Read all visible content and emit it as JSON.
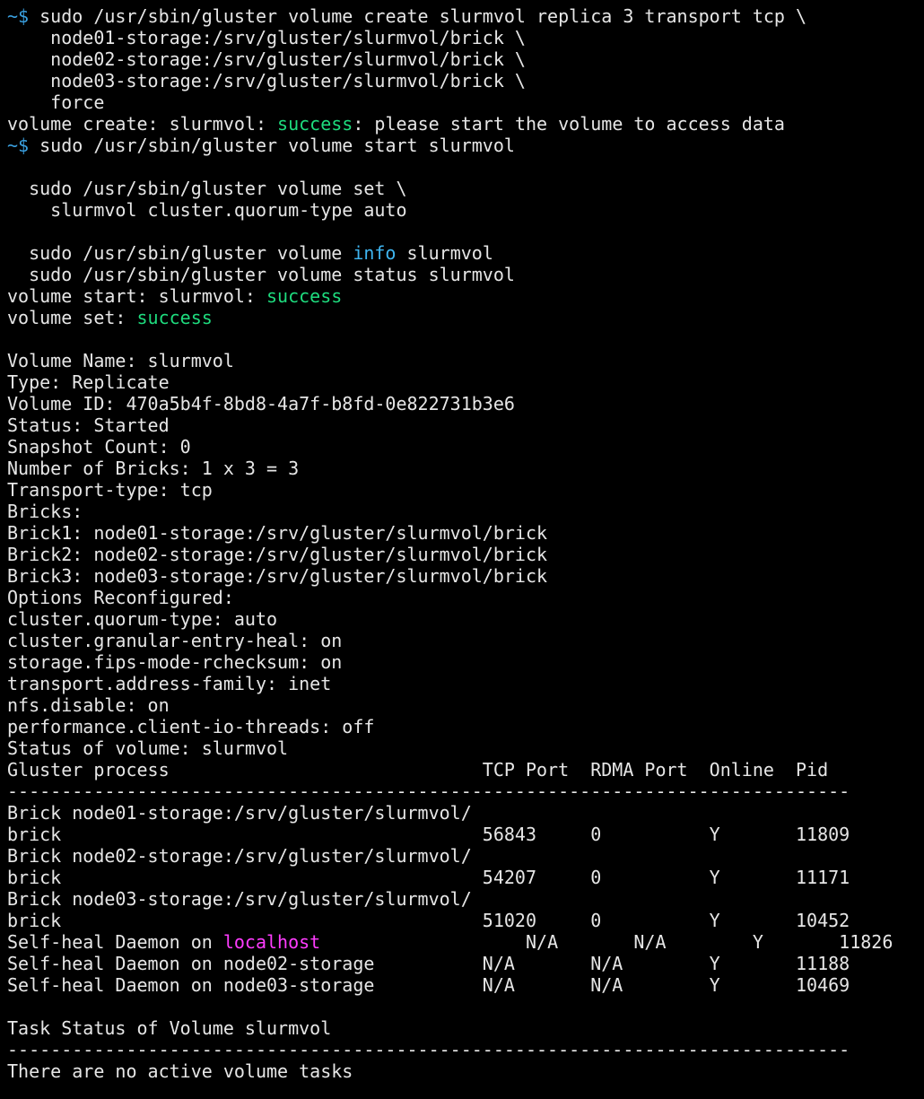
{
  "terminal": {
    "colors": {
      "background": "#000000",
      "foreground": "#e6e6e6",
      "prompt": "#3aa0e0",
      "success": "#1edc7e",
      "info": "#3fb5f0",
      "localhost": "#ff3cff"
    },
    "lines": [
      [
        {
          "t": "~$ ",
          "c": "prompt"
        },
        {
          "t": "sudo /usr/sbin/gluster volume create slurmvol replica 3 transport tcp \\"
        }
      ],
      [
        {
          "t": "    node01-storage:/srv/gluster/slurmvol/brick \\"
        }
      ],
      [
        {
          "t": "    node02-storage:/srv/gluster/slurmvol/brick \\"
        }
      ],
      [
        {
          "t": "    node03-storage:/srv/gluster/slurmvol/brick \\"
        }
      ],
      [
        {
          "t": "    force"
        }
      ],
      [
        {
          "t": "volume create: slurmvol: "
        },
        {
          "t": "success",
          "c": "green"
        },
        {
          "t": ": please start the volume to access data"
        }
      ],
      [
        {
          "t": "~$ ",
          "c": "prompt"
        },
        {
          "t": "sudo /usr/sbin/gluster volume start slurmvol"
        }
      ],
      [],
      [
        {
          "t": "  sudo /usr/sbin/gluster volume set \\"
        }
      ],
      [
        {
          "t": "    slurmvol cluster.quorum-type auto"
        }
      ],
      [],
      [
        {
          "t": "  sudo /usr/sbin/gluster volume "
        },
        {
          "t": "info",
          "c": "blue"
        },
        {
          "t": " slurmvol"
        }
      ],
      [
        {
          "t": "  sudo /usr/sbin/gluster volume status slurmvol"
        }
      ],
      [
        {
          "t": "volume start: slurmvol: "
        },
        {
          "t": "success",
          "c": "green"
        }
      ],
      [
        {
          "t": "volume set: "
        },
        {
          "t": "success",
          "c": "green"
        }
      ],
      [],
      [
        {
          "t": "Volume Name: slurmvol"
        }
      ],
      [
        {
          "t": "Type: Replicate"
        }
      ],
      [
        {
          "t": "Volume ID: 470a5b4f-8bd8-4a7f-b8fd-0e822731b3e6"
        }
      ],
      [
        {
          "t": "Status: Started"
        }
      ],
      [
        {
          "t": "Snapshot Count: 0"
        }
      ],
      [
        {
          "t": "Number of Bricks: 1 x 3 = 3"
        }
      ],
      [
        {
          "t": "Transport-type: tcp"
        }
      ],
      [
        {
          "t": "Bricks:"
        }
      ],
      [
        {
          "t": "Brick1: node01-storage:/srv/gluster/slurmvol/brick"
        }
      ],
      [
        {
          "t": "Brick2: node02-storage:/srv/gluster/slurmvol/brick"
        }
      ],
      [
        {
          "t": "Brick3: node03-storage:/srv/gluster/slurmvol/brick"
        }
      ],
      [
        {
          "t": "Options Reconfigured:"
        }
      ],
      [
        {
          "t": "cluster.quorum-type: auto"
        }
      ],
      [
        {
          "t": "cluster.granular-entry-heal: on"
        }
      ],
      [
        {
          "t": "storage.fips-mode-rchecksum: on"
        }
      ],
      [
        {
          "t": "transport.address-family: inet"
        }
      ],
      [
        {
          "t": "nfs.disable: on"
        }
      ],
      [
        {
          "t": "performance.client-io-threads: off"
        }
      ],
      [
        {
          "t": "Status of volume: slurmvol"
        }
      ],
      [
        {
          "t": "Gluster process                             TCP Port  RDMA Port  Online  Pid"
        }
      ],
      [
        {
          "t": "------------------------------------------------------------------------------"
        }
      ],
      [
        {
          "t": "Brick node01-storage:/srv/gluster/slurmvol/"
        }
      ],
      [
        {
          "t": "brick                                       56843     0          Y       11809"
        }
      ],
      [
        {
          "t": "Brick node02-storage:/srv/gluster/slurmvol/"
        }
      ],
      [
        {
          "t": "brick                                       54207     0          Y       11171"
        }
      ],
      [
        {
          "t": "Brick node03-storage:/srv/gluster/slurmvol/"
        }
      ],
      [
        {
          "t": "brick                                       51020     0          Y       10452"
        }
      ],
      [
        {
          "t": "Self-heal Daemon on "
        },
        {
          "t": "localhost",
          "c": "magenta"
        },
        {
          "t": "                   N/A       N/A        Y       11826"
        }
      ],
      [
        {
          "t": "Self-heal Daemon on node02-storage          N/A       N/A        Y       11188"
        }
      ],
      [
        {
          "t": "Self-heal Daemon on node03-storage          N/A       N/A        Y       10469"
        }
      ],
      [],
      [
        {
          "t": "Task Status of Volume slurmvol"
        }
      ],
      [
        {
          "t": "------------------------------------------------------------------------------"
        }
      ],
      [
        {
          "t": "There are no active volume tasks"
        }
      ]
    ]
  }
}
